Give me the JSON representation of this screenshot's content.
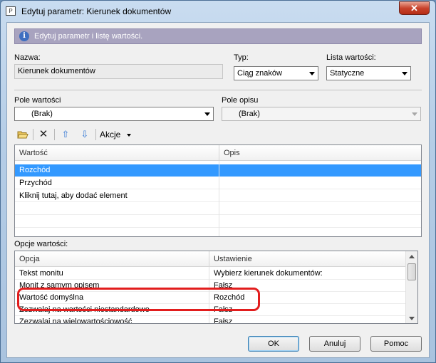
{
  "window": {
    "title": "Edytuj parametr: Kierunek dokumentów",
    "close_label": "✕",
    "icon_glyph": "P"
  },
  "info_bar": {
    "text": "Edytuj parametr i listę wartości.",
    "icon": "info-icon",
    "icon_glyph": "i",
    "color": "#a8a3bf"
  },
  "fields": {
    "name_label": "Nazwa:",
    "name_value": "Kierunek dokumentów",
    "type_label": "Typ:",
    "type_value": "Ciąg znaków",
    "list_label": "Lista wartości:",
    "list_value": "Statyczne",
    "value_field_label": "Pole wartości",
    "value_field_value": "(Brak)",
    "description_field_label": "Pole opisu",
    "description_field_value": "(Brak)"
  },
  "toolbar": {
    "open_icon": "folder-open-icon",
    "delete_icon": "delete-x-icon",
    "up_icon": "arrow-up-icon",
    "down_icon": "arrow-down-icon",
    "actions_label": "Akcje",
    "delete_glyph": "✕",
    "up_glyph": "⇧",
    "down_glyph": "⇩"
  },
  "values_table": {
    "columns": [
      "Wartość",
      "Opis"
    ],
    "rows": [
      {
        "value": "Rozchód",
        "description": "",
        "selected": true
      },
      {
        "value": "Przychód",
        "description": "",
        "selected": false
      },
      {
        "value": "Kliknij tutaj, aby dodać element",
        "description": "",
        "selected": false
      }
    ]
  },
  "options": {
    "label": "Opcje wartości:",
    "columns": [
      "Opcja",
      "Ustawienie"
    ],
    "rows": [
      {
        "option": "Tekst monitu",
        "setting": "Wybierz kierunek dokumentów:"
      },
      {
        "option": "Monit z samym opisem",
        "setting": "Fałsz"
      },
      {
        "option": "Wartość domyślna",
        "setting": "Rozchód"
      },
      {
        "option": "Zezwalaj na wartości niestandardowe",
        "setting": "Fałsz"
      },
      {
        "option": "Zezwalaj na wielowartościowość",
        "setting": "Fałsz"
      }
    ]
  },
  "buttons": {
    "ok": "OK",
    "cancel": "Anuluj",
    "help": "Pomoc"
  },
  "colors": {
    "selection": "#3399ff",
    "annotation": "#e21d1d"
  }
}
